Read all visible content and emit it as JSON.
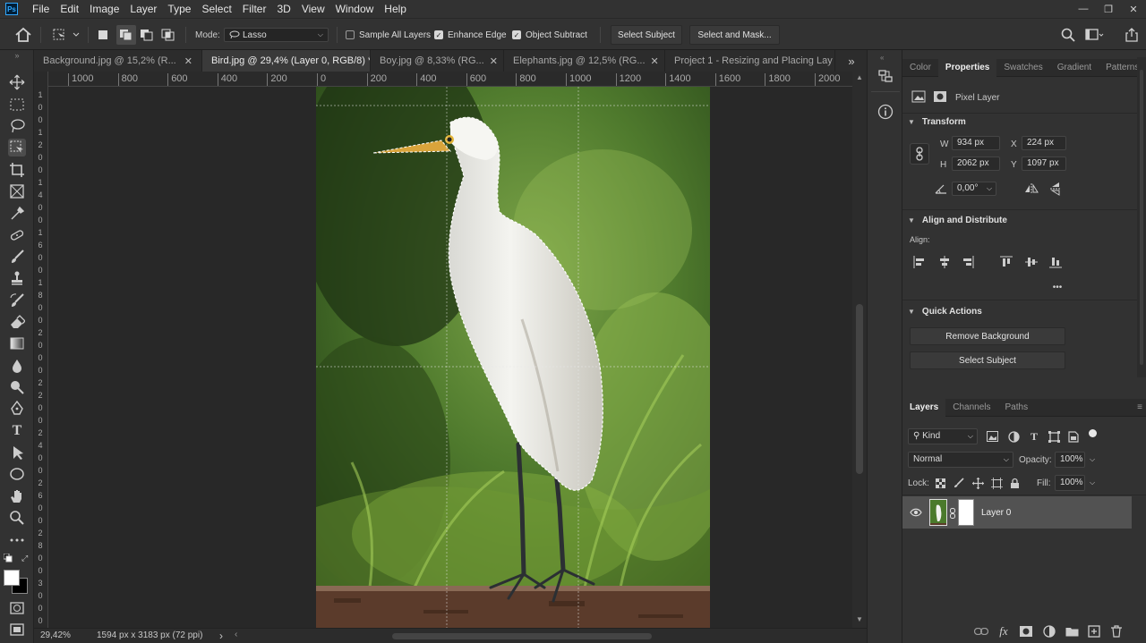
{
  "app": {
    "logo": "Ps"
  },
  "menu": [
    "File",
    "Edit",
    "Image",
    "Layer",
    "Type",
    "Select",
    "Filter",
    "3D",
    "View",
    "Window",
    "Help"
  ],
  "window_controls": {
    "minimize": "—",
    "restore": "❐",
    "close": "✕"
  },
  "options": {
    "mode_label": "Mode:",
    "mode_value": "Lasso",
    "sample_all_layers": "Sample All Layers",
    "enhance_edge": "Enhance Edge",
    "object_subtract": "Object Subtract",
    "select_subject": "Select Subject",
    "select_and_mask": "Select and Mask..."
  },
  "tabs": [
    {
      "label": "Background.jpg @ 15,2% (R...",
      "close": "✕",
      "active": false
    },
    {
      "label": "Bird.jpg @ 29,4% (Layer 0, RGB/8) *",
      "close": "✕",
      "active": true
    },
    {
      "label": "Boy.jpg @ 8,33% (RG...",
      "close": "✕",
      "active": false
    },
    {
      "label": "Elephants.jpg @ 12,5% (RG...",
      "close": "✕",
      "active": false
    },
    {
      "label": "Project 1 - Resizing and Placing Lay",
      "close": "",
      "active": false
    }
  ],
  "tabs_overflow": "»",
  "ruler_h": [
    "1000",
    "800",
    "600",
    "400",
    "200",
    "0",
    "200",
    "400",
    "600",
    "800",
    "1000",
    "1200",
    "1400",
    "1600",
    "1800",
    "2000"
  ],
  "ruler_v": [
    "1",
    "0",
    "0",
    "1",
    "2",
    "0",
    "0",
    "1",
    "4",
    "0",
    "0",
    "1",
    "6",
    "0",
    "0",
    "1",
    "8",
    "0",
    "0",
    "2",
    "0",
    "0",
    "0",
    "2",
    "2",
    "0",
    "0",
    "2",
    "4",
    "0",
    "0",
    "2",
    "6",
    "0",
    "0",
    "2",
    "8",
    "0",
    "0",
    "3",
    "0",
    "0",
    "0"
  ],
  "status": {
    "zoom": "29,42%",
    "doc_info": "1594 px x 3183 px (72 ppi)",
    "arrow": "›"
  },
  "properties": {
    "tabs": [
      "Color",
      "Properties",
      "Swatches",
      "Gradient",
      "Patterns"
    ],
    "pixel_layer": "Pixel Layer",
    "transform": {
      "title": "Transform",
      "w_label": "W",
      "w": "934 px",
      "x_label": "X",
      "x": "224 px",
      "h_label": "H",
      "h": "2062 px",
      "y_label": "Y",
      "y": "1097 px",
      "angle": "0,00°"
    },
    "align": {
      "title": "Align and Distribute",
      "label": "Align:",
      "more": "•••"
    },
    "quick_actions": {
      "title": "Quick Actions",
      "remove_bg": "Remove Background",
      "select_subject": "Select Subject"
    }
  },
  "layers": {
    "tabs": [
      "Layers",
      "Channels",
      "Paths"
    ],
    "kind": "Kind",
    "blend": "Normal",
    "opacity_label": "Opacity:",
    "opacity": "100%",
    "lock_label": "Lock:",
    "fill_label": "Fill:",
    "fill": "100%",
    "rows": [
      {
        "name": "Layer 0",
        "visible": true
      }
    ],
    "footer": {
      "fx": "fx"
    }
  },
  "colors": {
    "accent": "#31a8ff",
    "panel": "#323232",
    "canvas": "#282828"
  }
}
